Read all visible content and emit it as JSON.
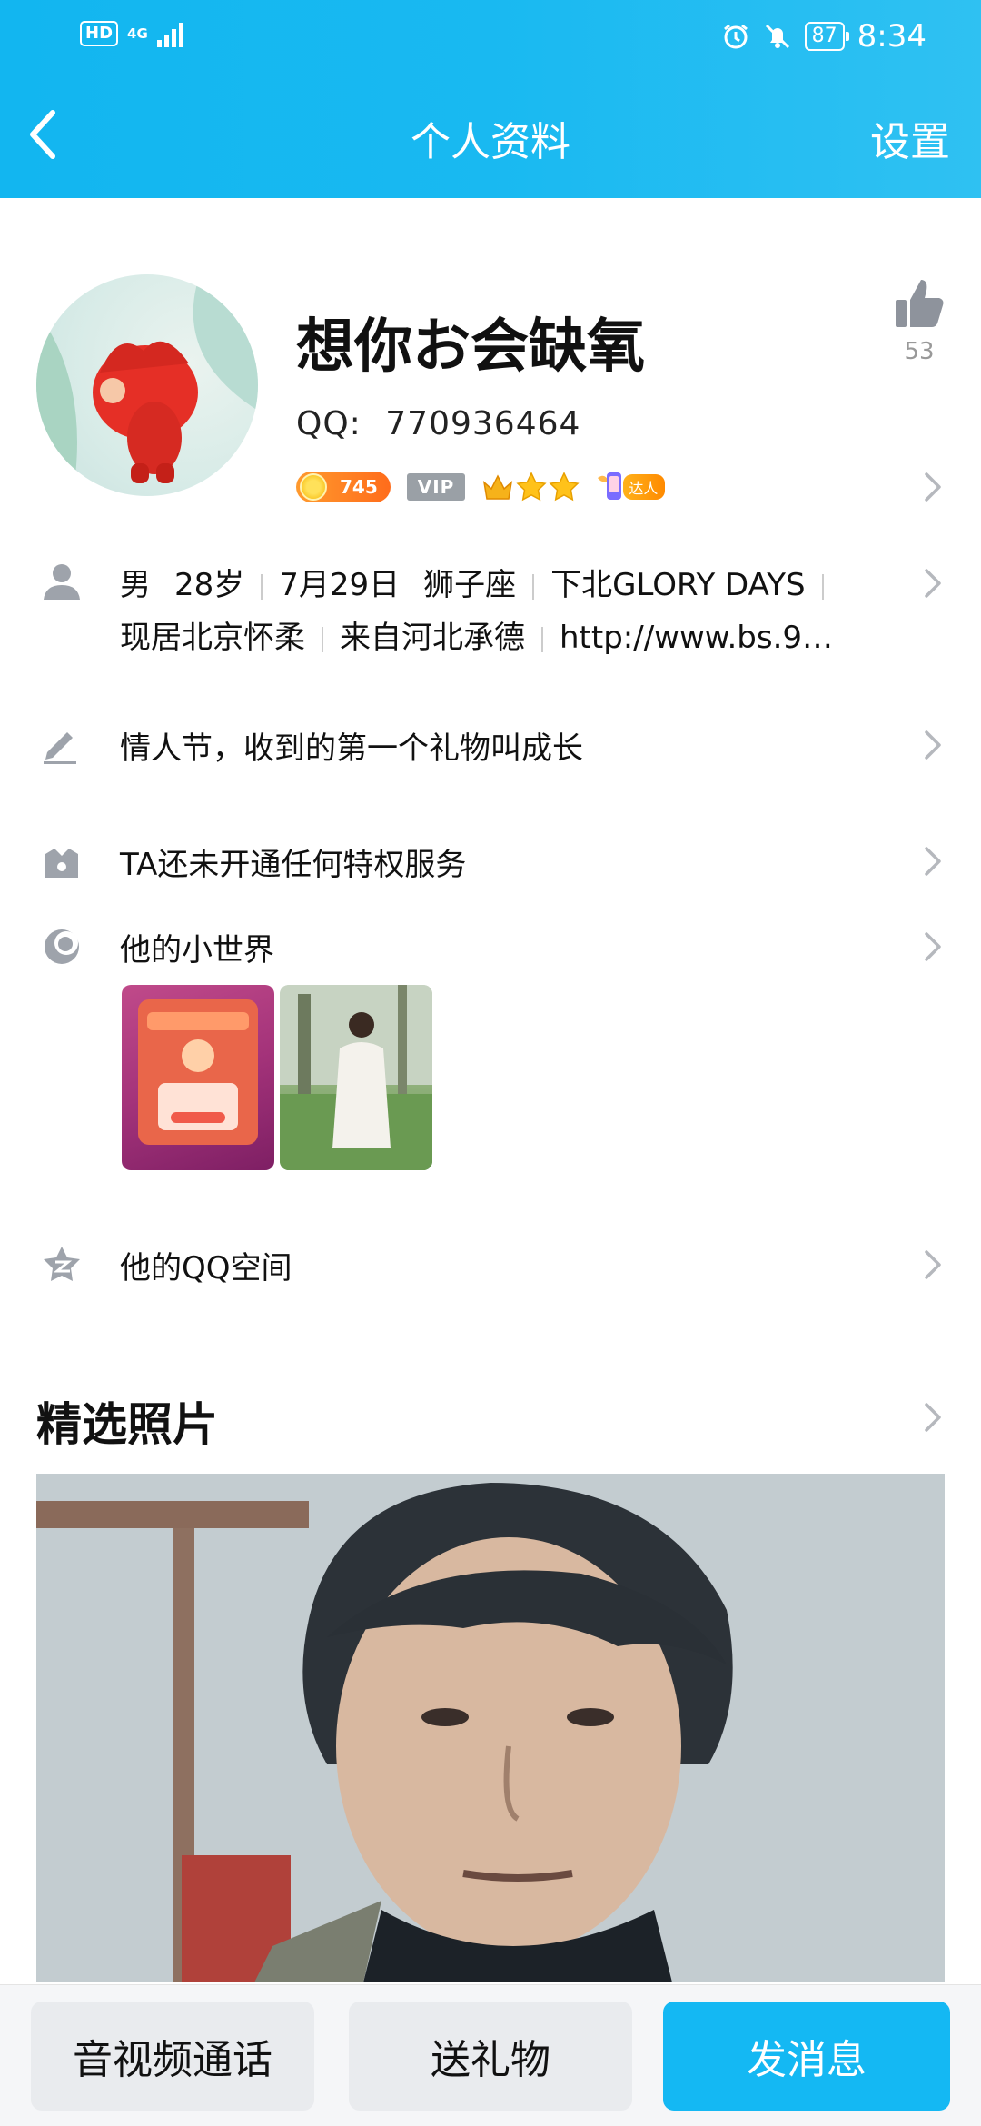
{
  "status_bar": {
    "hd": "HD",
    "network": "4G",
    "battery": "87",
    "time": "8:34"
  },
  "nav": {
    "title": "个人资料",
    "settings": "设置"
  },
  "profile": {
    "nickname": "想你お会缺氧",
    "qq_label": "QQ:",
    "qq_number": "770936464",
    "level_points": "745",
    "vip_label": "VIP",
    "daren_label": "达人",
    "like_count": "53"
  },
  "info": {
    "gender": "男",
    "age": "28岁",
    "birthday": "7月29日",
    "zodiac": "狮子座",
    "school": "下北GLORY DAYS",
    "location": "现居北京怀柔",
    "hometown": "来自河北承德",
    "website": "http://www.bs.9…"
  },
  "rows": {
    "signature": "情人节，收到的第一个礼物叫成长",
    "privilege": "TA还未开通任何特权服务",
    "small_world": "他的小世界",
    "qzone": "他的QQ空间"
  },
  "featured": {
    "title": "精选照片"
  },
  "bottom": {
    "call": "音视频通话",
    "gift": "送礼物",
    "message": "发消息"
  },
  "colors": {
    "header": "#19b9f1",
    "primary_button": "#14b8f3",
    "coin_badge": "#ff7f22"
  }
}
